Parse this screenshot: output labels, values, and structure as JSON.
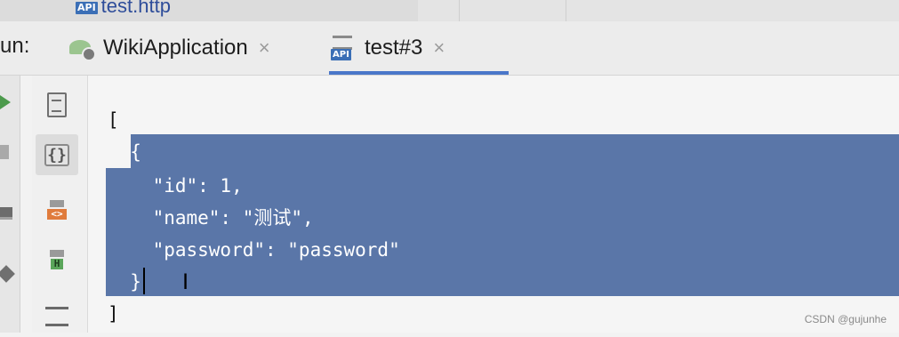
{
  "file_tab": {
    "badge": "API",
    "name": "test.http"
  },
  "run_panel": {
    "label": "un:",
    "tabs": [
      {
        "label": "WikiApplication",
        "close": "×"
      },
      {
        "label": "test#3",
        "badge": "API",
        "close": "×",
        "active": true
      }
    ]
  },
  "toolbar": {
    "braces_glyph": "{}",
    "html_tag": "<>",
    "header_tag": "H"
  },
  "editor": {
    "lines": [
      "[",
      "  {",
      "    \"id\": 1,",
      "    \"name\": \"测试\",",
      "    \"password\": \"password\"",
      "  }",
      "]"
    ],
    "cursor_glyph": "I"
  },
  "watermark": "CSDN @gujunhe",
  "colors": {
    "selection": "#5a76a8",
    "active_tab_underline": "#4a77c9",
    "api_badge": "#3b6fb6"
  }
}
